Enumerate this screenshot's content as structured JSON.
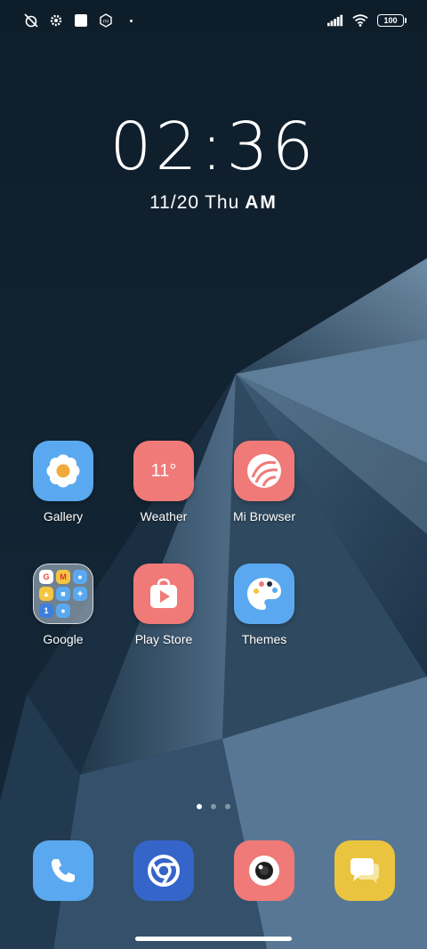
{
  "status_bar": {
    "battery": "100"
  },
  "lock": {
    "time": "02:36",
    "date": "11/20",
    "weekday": "Thu",
    "period": "AM"
  },
  "apps": {
    "gallery": {
      "label": "Gallery"
    },
    "weather": {
      "label": "Weather",
      "temp": "11°"
    },
    "browser": {
      "label": "Mi Browser"
    },
    "google": {
      "label": "Google"
    },
    "playstore": {
      "label": "Play Store"
    },
    "themes": {
      "label": "Themes"
    }
  },
  "pager": {
    "pages": 3,
    "current": 1
  },
  "dock": [
    "phone",
    "chrome",
    "camera",
    "messages"
  ],
  "colors": {
    "gallery": "#5aa9f0",
    "weather": "#f07a78",
    "browser": "#f07a78",
    "playstore": "#f07a78",
    "themes": "#5aa9f0",
    "phone": "#5aa9f0",
    "chrome": "#3565c9",
    "camera": "#f07a78",
    "messages": "#eac43e"
  }
}
